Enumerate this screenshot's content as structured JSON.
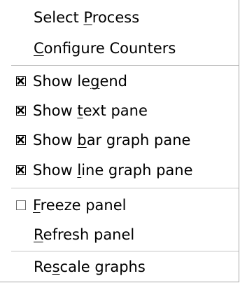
{
  "menu": {
    "items": [
      {
        "id": "select-process",
        "pre": "Select ",
        "mnemonic": "P",
        "post": "rocess",
        "checkable": false
      },
      {
        "id": "configure-counters",
        "pre": "",
        "mnemonic": "C",
        "post": "onfigure Counters",
        "checkable": false
      },
      {
        "id": "show-legend",
        "pre": "Show le",
        "mnemonic": "g",
        "post": "end",
        "checkable": true,
        "checked": true
      },
      {
        "id": "show-text-pane",
        "pre": "Show ",
        "mnemonic": "t",
        "post": "ext pane",
        "checkable": true,
        "checked": true
      },
      {
        "id": "show-bar-graph-pane",
        "pre": "Show ",
        "mnemonic": "b",
        "post": "ar graph pane",
        "checkable": true,
        "checked": true
      },
      {
        "id": "show-line-graph-pane",
        "pre": "Show ",
        "mnemonic": "l",
        "post": "ine graph pane",
        "checkable": true,
        "checked": true
      },
      {
        "id": "freeze-panel",
        "pre": "",
        "mnemonic": "F",
        "post": "reeze panel",
        "checkable": true,
        "checked": false
      },
      {
        "id": "refresh-panel",
        "pre": "",
        "mnemonic": "R",
        "post": "efresh panel",
        "checkable": false
      },
      {
        "id": "rescale-graphs",
        "pre": "Re",
        "mnemonic": "s",
        "post": "cale graphs",
        "checkable": false
      }
    ]
  }
}
